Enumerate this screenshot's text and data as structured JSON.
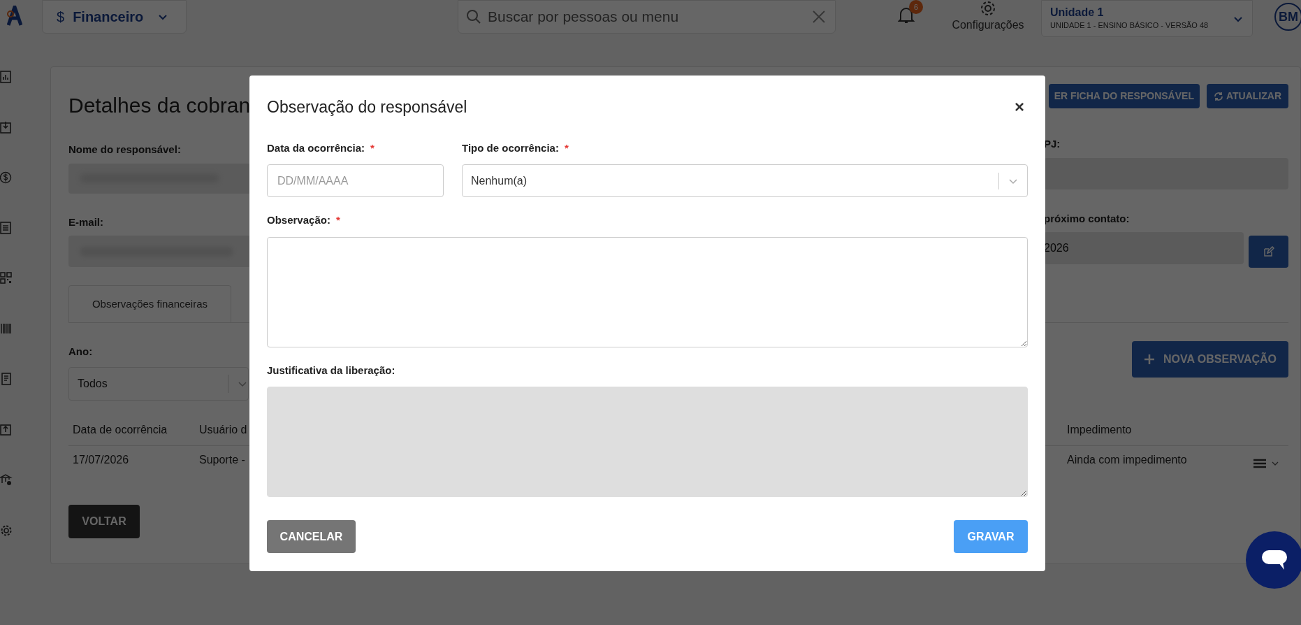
{
  "top_bar": {
    "module": {
      "icon": "$",
      "label": "Financeiro"
    },
    "search": {
      "placeholder": "Buscar por pessoas ou menu"
    },
    "notifications": {
      "count": "6"
    },
    "settings": {
      "label": "Configurações"
    },
    "unit": {
      "name": "Unidade 1",
      "detail": "UNIDADE 1 - ENSINO BÁSICO - VERSÃO 48"
    },
    "avatar": "BM"
  },
  "page": {
    "title": "Detalhes da cobran",
    "buttons": [
      "ER FICHA DO RESPONSÁVEL",
      "ATUALIZAR"
    ],
    "fields_left": [
      "Nome do responsável:",
      "E-mail:"
    ],
    "fields_right": [
      {
        "label": "PJ:"
      },
      {
        "label": "próximo contato:",
        "value": "2026"
      }
    ],
    "tabs": [
      {
        "label": "Observações financeiras",
        "selected": true
      }
    ],
    "year": {
      "label": "Ano:",
      "value": "Todos"
    },
    "new_button": "NOVA OBSERVAÇÃO",
    "table": {
      "columns": [
        "Data de ocorrência",
        "Usuário d",
        "Impedimento"
      ],
      "rows": [
        [
          "17/07/2026",
          "Suporte -",
          "Ainda com impedimento"
        ]
      ]
    },
    "back_button": "VOLTAR"
  },
  "modal": {
    "title": "Observação do responsável",
    "close": "×",
    "fields": [
      {
        "kind": "date",
        "label": "Data da ocorrência:",
        "required_mark": "*",
        "placeholder": "DD/MM/AAAA",
        "disabled": false
      },
      {
        "kind": "select",
        "label": "Tipo de ocorrência:",
        "required_mark": "*",
        "value": "Nenhum(a)",
        "disabled": false
      },
      {
        "kind": "textarea",
        "label": "Observação:",
        "required_mark": "*",
        "disabled": false
      },
      {
        "kind": "textarea",
        "label": "Justificativa da liberação:",
        "disabled": true
      }
    ],
    "buttons": [
      {
        "kind": "secondary",
        "label": "CANCELAR"
      },
      {
        "kind": "primary",
        "label": "GRAVAR"
      }
    ]
  }
}
